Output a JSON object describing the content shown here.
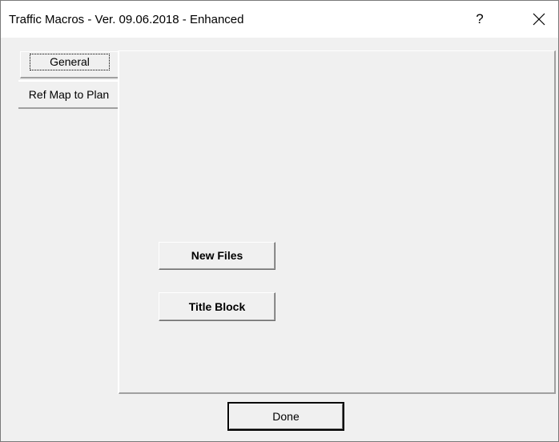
{
  "window": {
    "title": "Traffic Macros - Ver. 09.06.2018 - Enhanced",
    "help_glyph": "?",
    "close_glyph": "×"
  },
  "tabs": [
    {
      "label": "General",
      "active": true
    },
    {
      "label": "Ref Map to Plan",
      "active": false
    }
  ],
  "general_page": {
    "new_files_label": "New Files",
    "title_block_label": "Title Block"
  },
  "footer": {
    "done_label": "Done"
  }
}
